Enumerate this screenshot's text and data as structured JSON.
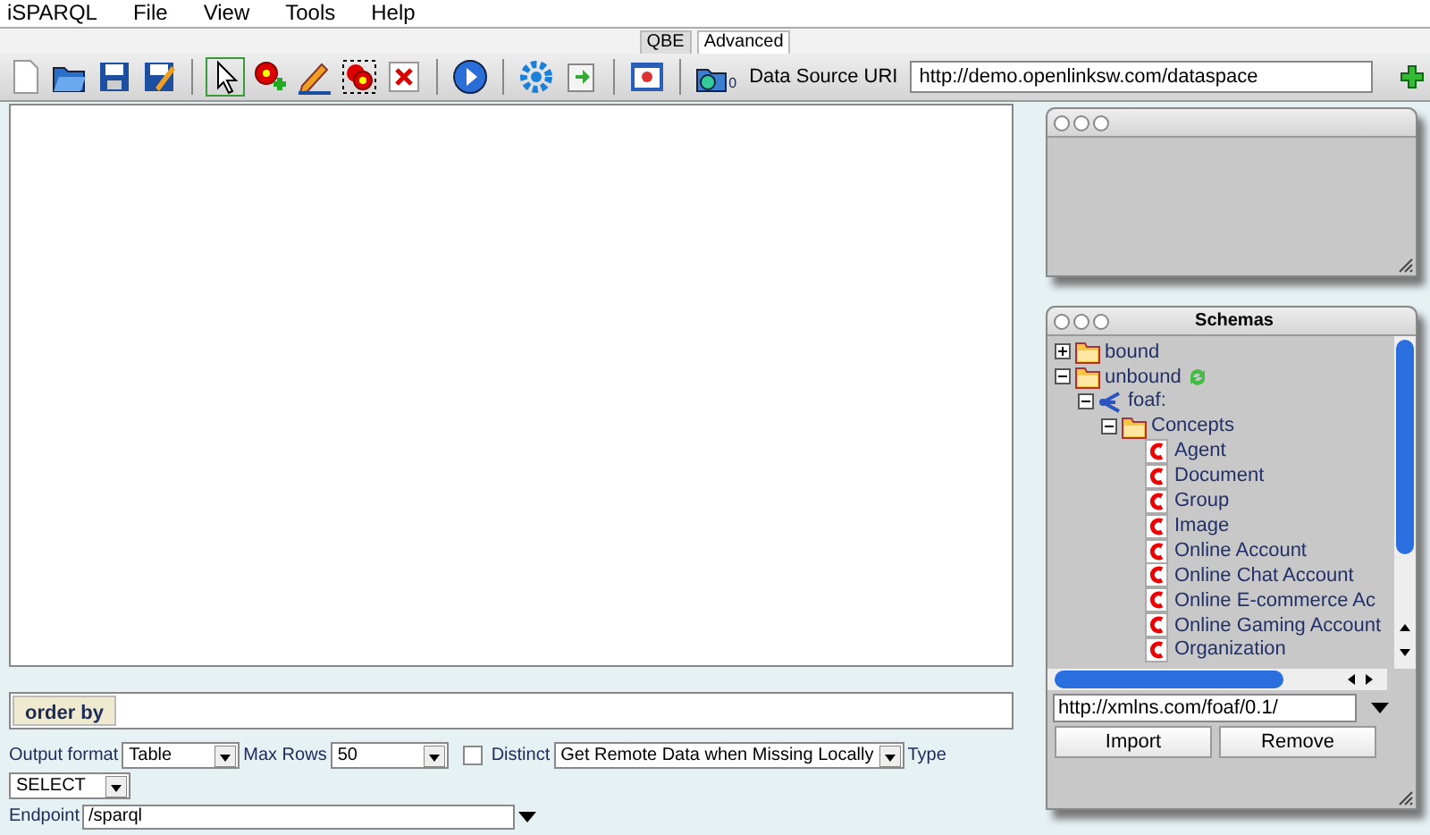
{
  "menu": [
    {
      "label": "iSPARQL"
    },
    {
      "label": "File"
    },
    {
      "label": "View"
    },
    {
      "label": "Tools"
    },
    {
      "label": "Help"
    }
  ],
  "view_tabs": [
    {
      "label": "QBE",
      "selected": true
    },
    {
      "label": "Advanced",
      "selected": false
    }
  ],
  "tools": [
    {
      "kind": "pointer",
      "selected": true
    },
    {
      "kind": "add",
      "selected": false
    },
    {
      "kind": "edit",
      "selected": false
    },
    {
      "kind": "group",
      "selected": false
    },
    {
      "kind": "delete",
      "selected": false
    }
  ],
  "data_source": {
    "count": "0",
    "label": "Data Source URI",
    "value": "http://demo.openlinksw.com/dataspace"
  },
  "schemas": {
    "title": "Schemas",
    "tree": [
      {
        "label": "bound",
        "kind": "folder",
        "expanded": false
      },
      {
        "label": "unbound",
        "kind": "folder",
        "expanded": true,
        "sync": true,
        "children": [
          {
            "label": "foaf:",
            "kind": "namespace",
            "expanded": true,
            "children": [
              {
                "label": "Concepts",
                "kind": "folder",
                "expanded": true,
                "children": [
                  {
                    "label": "Agent",
                    "kind": "class"
                  },
                  {
                    "label": "Document",
                    "kind": "class"
                  },
                  {
                    "label": "Group",
                    "kind": "class"
                  },
                  {
                    "label": "Image",
                    "kind": "class"
                  },
                  {
                    "label": "Online Account",
                    "kind": "class"
                  },
                  {
                    "label": "Online Chat Account",
                    "kind": "class"
                  },
                  {
                    "label": "Online E-commerce Ac",
                    "kind": "class"
                  },
                  {
                    "label": "Online Gaming Account",
                    "kind": "class"
                  },
                  {
                    "label": "Organization",
                    "kind": "class"
                  }
                ]
              }
            ]
          }
        ]
      }
    ],
    "url": "http://xmlns.com/foaf/0.1/",
    "buttons": [
      {
        "label": "Import"
      },
      {
        "label": "Remove"
      }
    ]
  },
  "order_by": {
    "label": "order by"
  },
  "options": {
    "output_format": {
      "label": "Output format",
      "value": "Table"
    },
    "max_rows": {
      "label": "Max Rows",
      "value": "50"
    },
    "distinct": {
      "label": "Distinct",
      "checked": false
    },
    "remote": {
      "value": "Get Remote Data when Missing Locally"
    },
    "type": {
      "label": "Type",
      "value": "SELECT"
    },
    "endpoint": {
      "label": "Endpoint",
      "value": "/sparql"
    }
  }
}
